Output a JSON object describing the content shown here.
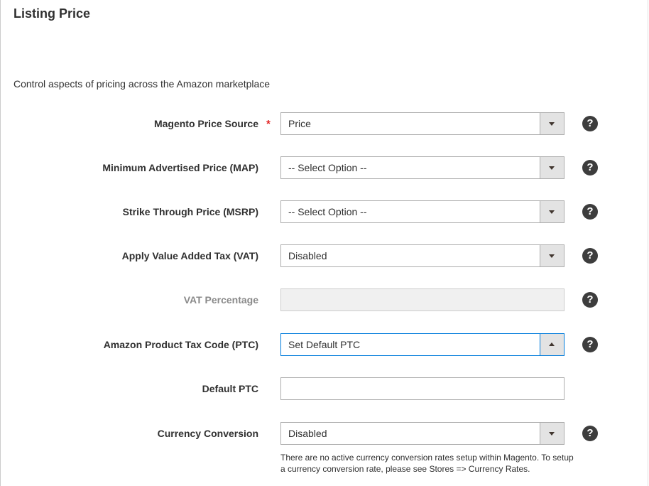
{
  "section": {
    "title": "Listing Price",
    "description": "Control aspects of pricing across the Amazon marketplace"
  },
  "fields": {
    "price_source": {
      "label": "Magento Price Source",
      "required_mark": "*",
      "value": "Price"
    },
    "map": {
      "label": "Minimum Advertised Price (MAP)",
      "value": "-- Select Option --"
    },
    "msrp": {
      "label": "Strike Through Price (MSRP)",
      "value": "-- Select Option --"
    },
    "vat": {
      "label": "Apply Value Added Tax (VAT)",
      "value": "Disabled"
    },
    "vat_percentage": {
      "label": "VAT Percentage",
      "value": ""
    },
    "ptc": {
      "label": "Amazon Product Tax Code (PTC)",
      "value": "Set Default PTC"
    },
    "default_ptc": {
      "label": "Default PTC",
      "value": ""
    },
    "currency_conversion": {
      "label": "Currency Conversion",
      "value": "Disabled",
      "note": "There are no active currency conversion rates setup within Magento. To setup a currency conversion rate, please see Stores => Currency Rates."
    }
  },
  "help_icon_glyph": "?",
  "colors": {
    "required": "#e22626",
    "focus_border": "#007bdb",
    "help_icon_bg": "#3d3d3d"
  }
}
